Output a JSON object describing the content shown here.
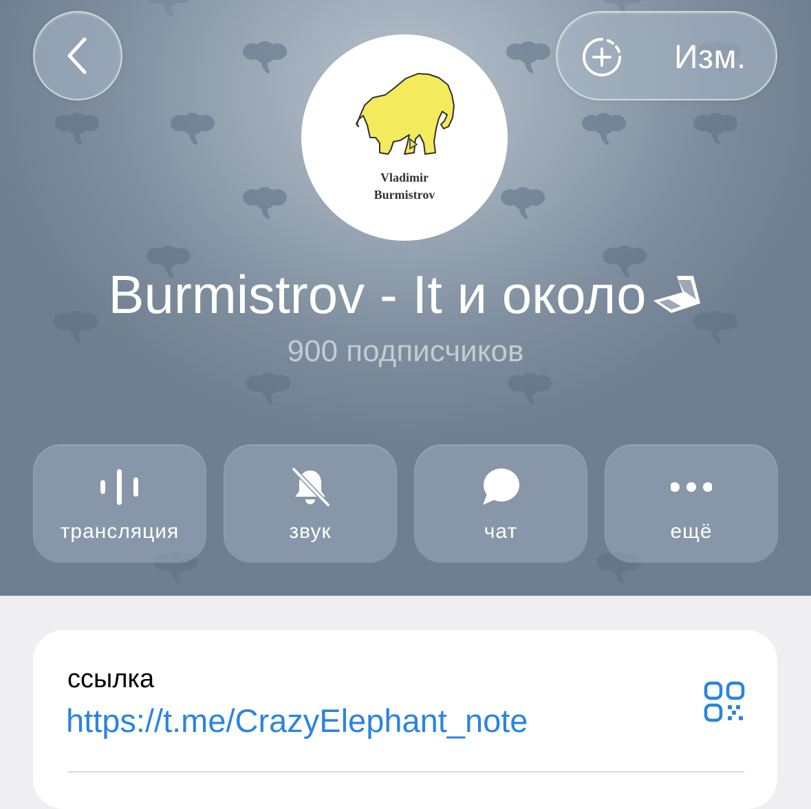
{
  "header": {
    "edit_label": "Изм.",
    "channel_title": "Burmistrov - It и около",
    "title_emoji": "laptop-emoji",
    "subscribers": "900 подписчиков",
    "background_color": "#8a99a9"
  },
  "avatar": {
    "line1": "Vladimir",
    "line2": "Burmistrov",
    "mammoth_color": "#f3ea5d"
  },
  "actions": [
    {
      "label": "трансляция",
      "icon": "live-stream-icon"
    },
    {
      "label": "звук",
      "icon": "bell-muted-icon"
    },
    {
      "label": "чат",
      "icon": "chat-bubble-icon"
    },
    {
      "label": "ещё",
      "icon": "more-dots-icon"
    }
  ],
  "link_card": {
    "label": "ссылка",
    "url": "https://t.me/CrazyElephant_note",
    "link_color": "#2a84e0"
  }
}
